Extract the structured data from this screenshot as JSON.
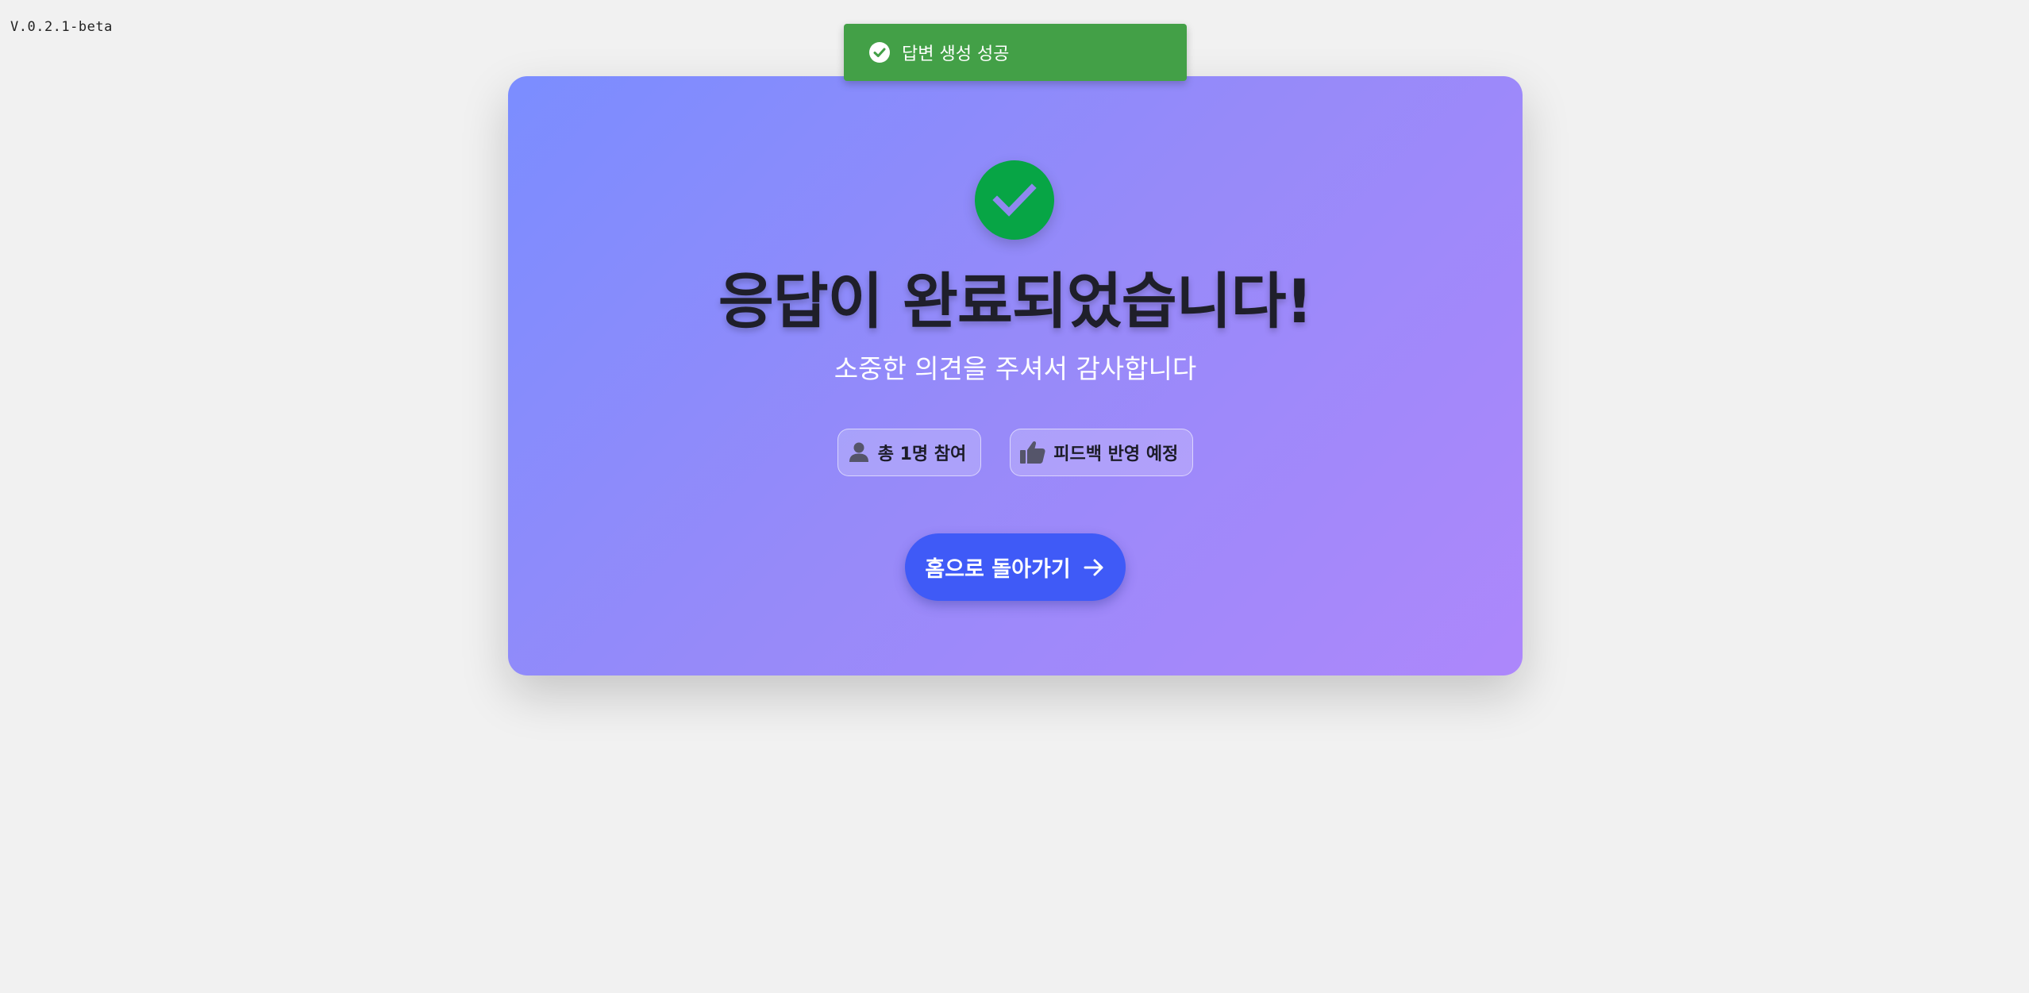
{
  "app": {
    "version": "V.0.2.1-beta"
  },
  "toast": {
    "message": "답변 생성 성공",
    "icon": "check-circle-icon",
    "color": "#43a047"
  },
  "card": {
    "status_icon": "check-icon",
    "title": "응답이 완료되었습니다!",
    "subtitle": "소중한 의견을 주셔서 감사합니다",
    "badges": [
      {
        "icon": "person-icon",
        "label": "총 1명 참여"
      },
      {
        "icon": "thumbs-up-icon",
        "label": "피드백 반영 예정"
      }
    ],
    "home_button": {
      "label": "홈으로 돌아가기",
      "icon": "arrow-right-icon"
    }
  },
  "colors": {
    "success_green": "#07a545",
    "button_blue": "#3f5af7",
    "gradient_start": "#7b8dff",
    "gradient_end": "#ad87fb"
  }
}
